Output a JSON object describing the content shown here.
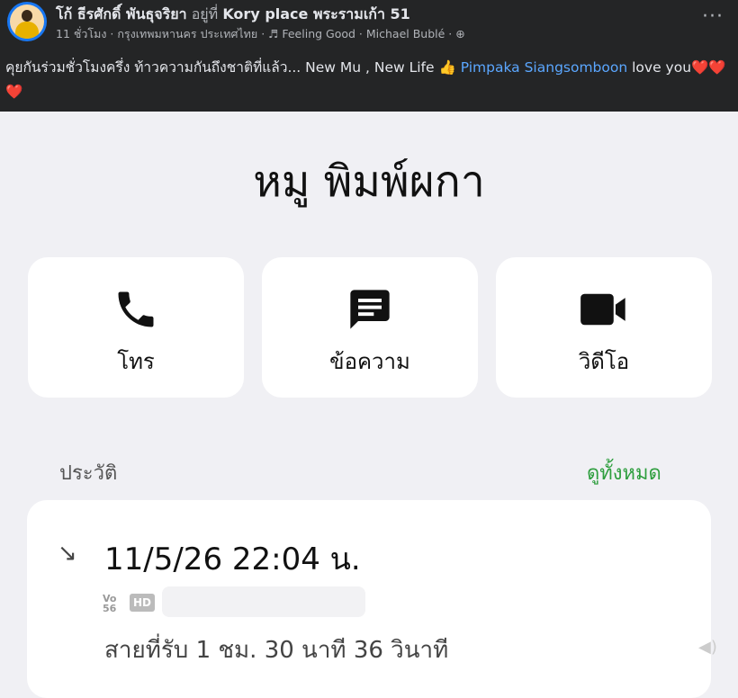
{
  "post": {
    "author": "โก้ ธีรศักดิ์ พันธุจริยา",
    "at_text": "อยู่ที่",
    "place": "Kory place พระรามเก้า 51",
    "time": "11 ชั่วโมง · กรุงเทพมหานคร ประเทศไทย · ",
    "music": "Feeling Good · Michael Bublé · ",
    "text_main": "คุยกันร่วมชั่วโมงครึ่ง ท้าวความกันถึงชาติที่แล้ว... New Mu , New Life ",
    "mention": "Pimpaka Siangsomboon",
    "text_love": " love you",
    "hearts": "❤️❤️❤️",
    "more": "···"
  },
  "contact": {
    "name": "หมู พิมพ์ผกา"
  },
  "actions": [
    {
      "label": "โทร",
      "icon": "phone-icon"
    },
    {
      "label": "ข้อความ",
      "icon": "message-icon"
    },
    {
      "label": "วิดีโอ",
      "icon": "video-icon"
    }
  ],
  "history": {
    "label": "ประวัติ",
    "see_all": "ดูทั้งหมด",
    "entries": [
      {
        "datetime": "11/5/26 22:04 น.",
        "network_vo": "Vo",
        "network_num": "56",
        "hd": "HD",
        "duration": "สายที่รับ  1 ชม. 30 นาที 36 วินาที"
      }
    ]
  },
  "colors": {
    "fb_background": "#242526",
    "mention": "#5ba7ff",
    "see_all": "#2e9e3e",
    "phone_background": "#f0f0f4"
  }
}
